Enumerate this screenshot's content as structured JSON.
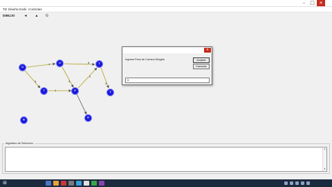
{
  "menu": [
    {
      "label": "TD"
    },
    {
      "label": "Diseño"
    },
    {
      "label": "Grafo"
    },
    {
      "label": "Controles"
    }
  ],
  "toolbar": {
    "label": "DIBUJO",
    "buttons": [
      {
        "label": "◄"
      },
      {
        "label": "▲"
      },
      {
        "label": "G"
      }
    ]
  },
  "graph": {
    "nodes": [
      {
        "id": "a",
        "label": "O"
      },
      {
        "id": "b",
        "label": "U"
      },
      {
        "id": "c",
        "label": "T"
      },
      {
        "id": "d",
        "label": "T"
      },
      {
        "id": "e",
        "label": "P"
      },
      {
        "id": "f",
        "label": "Y"
      },
      {
        "id": "g",
        "label": "R"
      },
      {
        "id": "h",
        "label": "B"
      }
    ],
    "edges": [
      {
        "from": "a",
        "to": "b",
        "label": "1"
      },
      {
        "from": "b",
        "to": "c",
        "label": "8"
      },
      {
        "from": "a",
        "to": "d",
        "label": "3"
      },
      {
        "from": "d",
        "to": "e",
        "label": "1"
      },
      {
        "from": "b",
        "to": "e",
        "label": "3"
      },
      {
        "from": "e",
        "to": "c",
        "label": "2"
      },
      {
        "from": "c",
        "to": "f",
        "label": "3"
      },
      {
        "from": "e",
        "to": "g",
        "label": ""
      }
    ]
  },
  "dialog": {
    "prompt": "Ingrese Peso de Camino Elegido",
    "accept_label": "Aceptar",
    "cancel_label": "Cancelar",
    "input_value": "5"
  },
  "output": {
    "title": "Algoritmo de Seleccion",
    "text": ""
  },
  "taskbar": {
    "start_icon": "windows-logo-icon",
    "time": "",
    "date": ""
  },
  "colors": {
    "node_fill": "#1a1ad6",
    "node_border": "#7a7aff",
    "edge": "#b0a020",
    "edge_arrow": "#555555",
    "close_button": "#c42b1c",
    "taskbar": "#1c2a3e"
  }
}
